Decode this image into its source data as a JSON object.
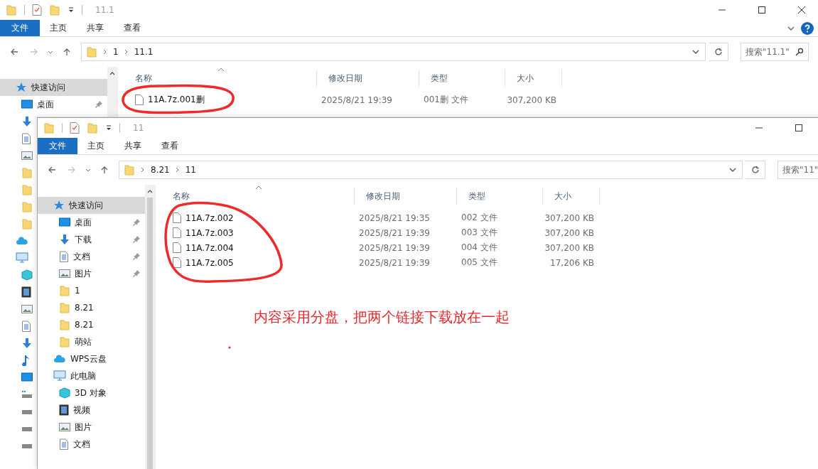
{
  "windows": [
    {
      "title": "11.1",
      "ribbon_tabs": [
        {
          "label": "文件",
          "selected": true
        },
        {
          "label": "主页",
          "selected": false
        },
        {
          "label": "共享",
          "selected": false
        },
        {
          "label": "查看",
          "selected": false
        }
      ],
      "breadcrumb": [
        "1",
        "11.1"
      ],
      "search": {
        "placeholder": "搜索\"11.1\""
      },
      "columns": [
        "名称",
        "修改日期",
        "类型",
        "大小"
      ],
      "files": [
        {
          "name": "11A.7z.001删",
          "modified": "2025/8/21 19:39",
          "type": "001删 文件",
          "size": "307,200 KB"
        }
      ],
      "nav": [
        {
          "label": "快速访问",
          "kind": "star",
          "selected": true,
          "children": [
            {
              "label": "桌面",
              "kind": "desktop",
              "pinned": true,
              "selected": false
            },
            {
              "kind": "download",
              "pinned": false,
              "selected": false
            },
            {
              "kind": "document",
              "pinned": false,
              "selected": false
            },
            {
              "kind": "picture",
              "pinned": false,
              "selected": false
            },
            {
              "kind": "folder",
              "pinned": false,
              "selected": false
            },
            {
              "kind": "folder",
              "pinned": false,
              "selected": false
            },
            {
              "kind": "folder",
              "pinned": false,
              "selected": false
            },
            {
              "kind": "folder",
              "pinned": false,
              "selected": false
            }
          ]
        },
        {
          "kind": "cloud",
          "selected": false
        },
        {
          "kind": "pc",
          "selected": false,
          "children": [
            {
              "kind": "cube",
              "pinned": false,
              "selected": false
            },
            {
              "kind": "film",
              "pinned": false,
              "selected": false
            },
            {
              "kind": "picture",
              "pinned": false,
              "selected": false
            },
            {
              "kind": "document",
              "pinned": false,
              "selected": false
            },
            {
              "kind": "download",
              "pinned": false,
              "selected": false
            },
            {
              "kind": "music",
              "pinned": false,
              "selected": false
            },
            {
              "kind": "desktop",
              "pinned": false,
              "selected": false
            },
            {
              "kind": "windrive",
              "pinned": false,
              "selected": false
            },
            {
              "kind": "drive",
              "pinned": false,
              "selected": false
            },
            {
              "kind": "drive",
              "pinned": false,
              "selected": false
            },
            {
              "kind": "drive",
              "pinned": false,
              "selected": false
            }
          ]
        }
      ]
    },
    {
      "title": "11",
      "ribbon_tabs": [
        {
          "label": "文件",
          "selected": true
        },
        {
          "label": "主页",
          "selected": false
        },
        {
          "label": "共享",
          "selected": false
        },
        {
          "label": "查看",
          "selected": false
        }
      ],
      "breadcrumb": [
        "8.21",
        "11"
      ],
      "search": {
        "placeholder": "搜索\"11\""
      },
      "columns": [
        "名称",
        "修改日期",
        "类型",
        "大小"
      ],
      "files": [
        {
          "name": "11A.7z.002",
          "modified": "2025/8/21 19:35",
          "type": "002 文件",
          "size": "307,200 KB"
        },
        {
          "name": "11A.7z.003",
          "modified": "2025/8/21 19:39",
          "type": "003 文件",
          "size": "307,200 KB"
        },
        {
          "name": "11A.7z.004",
          "modified": "2025/8/21 19:39",
          "type": "004 文件",
          "size": "307,200 KB"
        },
        {
          "name": "11A.7z.005",
          "modified": "2025/8/21 19:39",
          "type": "005 文件",
          "size": "17,206 KB"
        }
      ],
      "nav": [
        {
          "label": "快速访问",
          "kind": "star",
          "selected": true,
          "children": [
            {
              "label": "桌面",
              "kind": "desktop",
              "pinned": true,
              "selected": false
            },
            {
              "label": "下载",
              "kind": "download",
              "pinned": true,
              "selected": false
            },
            {
              "label": "文档",
              "kind": "document",
              "pinned": true,
              "selected": false
            },
            {
              "label": "图片",
              "kind": "picture",
              "pinned": true,
              "selected": false
            },
            {
              "label": "1",
              "kind": "folder",
              "pinned": false,
              "selected": false
            },
            {
              "label": "8.21",
              "kind": "folder",
              "pinned": false,
              "selected": false
            },
            {
              "label": "8.21",
              "kind": "folder",
              "pinned": false,
              "selected": false
            },
            {
              "label": "萌站",
              "kind": "folder",
              "pinned": false,
              "selected": false
            }
          ]
        },
        {
          "label": "WPS云盘",
          "kind": "cloud",
          "selected": false
        },
        {
          "label": "此电脑",
          "kind": "pc",
          "selected": false,
          "children": [
            {
              "label": "3D 对象",
              "kind": "cube",
              "pinned": false,
              "selected": false
            },
            {
              "label": "视频",
              "kind": "film",
              "pinned": false,
              "selected": false
            },
            {
              "label": "图片",
              "kind": "picture",
              "pinned": false,
              "selected": false
            },
            {
              "label": "文档",
              "kind": "document",
              "pinned": false,
              "selected": false
            }
          ]
        }
      ]
    }
  ],
  "annotation": {
    "text": "内容采用分盘，把两个链接下载放在一起"
  }
}
